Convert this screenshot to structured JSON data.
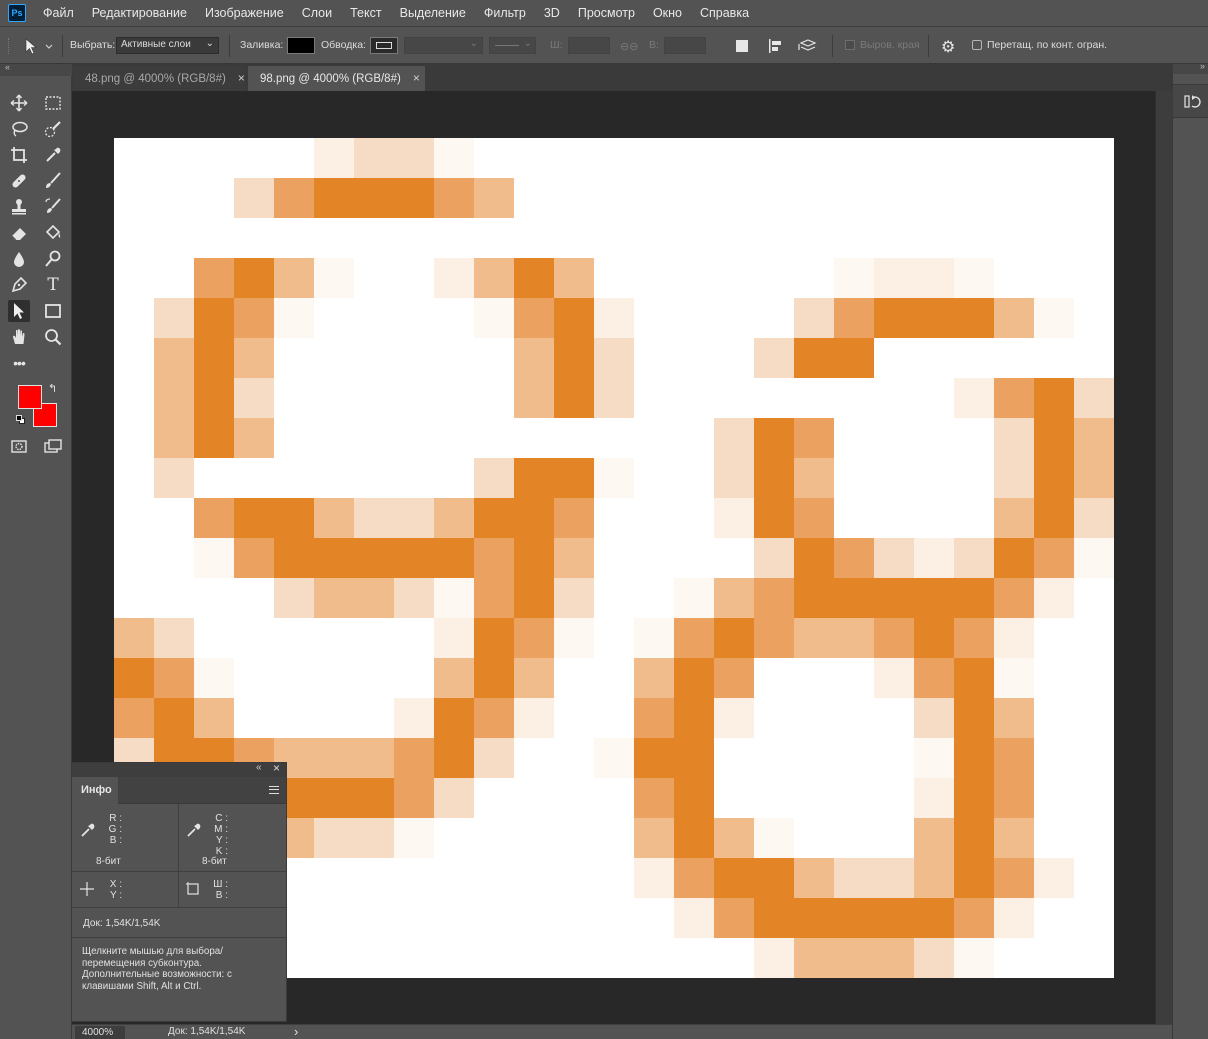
{
  "app": {
    "logo": "Ps"
  },
  "menu": [
    "Файл",
    "Редактирование",
    "Изображение",
    "Слои",
    "Текст",
    "Выделение",
    "Фильтр",
    "3D",
    "Просмотр",
    "Окно",
    "Справка"
  ],
  "options": {
    "select_label": "Выбрать:",
    "select_value": "Активные слои",
    "fill_label": "Заливка:",
    "stroke_label": "Обводка:",
    "width_label": "Ш:",
    "height_label": "В:",
    "align_edges": "Выров. края",
    "drag_label": "Перетащ. по конт. огран."
  },
  "tabs": [
    {
      "title": "48.png @ 4000% (RGB/8#)",
      "close": "×"
    },
    {
      "title": "98.png @ 4000% (RGB/8#)",
      "close": "×"
    }
  ],
  "colors": {
    "foreground": "#ff0000",
    "background": "#ff0000",
    "accent_orange": "#e38526"
  },
  "icons": {
    "toolbar": [
      "move-icon",
      "marquee-icon",
      "lasso-icon",
      "quick-select-icon",
      "crop-icon",
      "eyedropper-icon",
      "healing-icon",
      "brush-icon",
      "stamp-icon",
      "history-brush-icon",
      "eraser-icon",
      "paint-bucket-icon",
      "blur-icon",
      "dodge-icon",
      "pen-icon",
      "type-icon",
      "path-select-icon",
      "rectangle-icon",
      "hand-icon",
      "zoom-icon",
      "more-tools-icon",
      "quick-mask-icon",
      "screen-mode-icon"
    ]
  },
  "info_panel": {
    "tab": "Инфо",
    "rgb_labels": [
      "R :",
      "G :",
      "B :"
    ],
    "cmyk_labels": [
      "C :",
      "M :",
      "Y :",
      "K :"
    ],
    "bit_left": "8-бит",
    "bit_right": "8-бит",
    "xy_labels": [
      "X :",
      "Y :"
    ],
    "wh_labels": [
      "Ш :",
      "В :"
    ],
    "doc_size": "Док: 1,54K/1,54K",
    "hint": "Щелкните мышью для выбора/перемещения субконтура. Дополнительные возможности: с клавишами Shift, Alt и Ctrl."
  },
  "status": {
    "zoom": "4000%",
    "doc": "Док: 1,54K/1,54K",
    "arrow": "›"
  },
  "canvas": {
    "pixel_colors": {
      "1": "#fcefe4",
      "2": "#f6dcc4",
      "3": "#f0bc8c",
      "4": "#eba261",
      "5": "#e38526",
      "6": "#fdf8f2"
    },
    "rows": [
      "0000010000000000000000000",
      "0000000000000000000000000",
      "0000000000000000000000000",
      "0000000000000000000000000",
      "0000000000000000000000000",
      "0000000000000000000000000",
      "0000000000000000000000000",
      "0000000000000000000000000",
      "0000000000000000000000000",
      "0000000000000000000000000",
      "0000000000000000000000000",
      "0000000000000000000000000",
      "0000000000000000000000000",
      "0000000000000000000000000",
      "0000000000000000000000000",
      "0000000000000000000000000",
      "0000000000000000000000000",
      "0000000000000000000000000",
      "0000000000000000000000000",
      "0000000000000000000000000",
      "0000000000000000000000000"
    ]
  }
}
